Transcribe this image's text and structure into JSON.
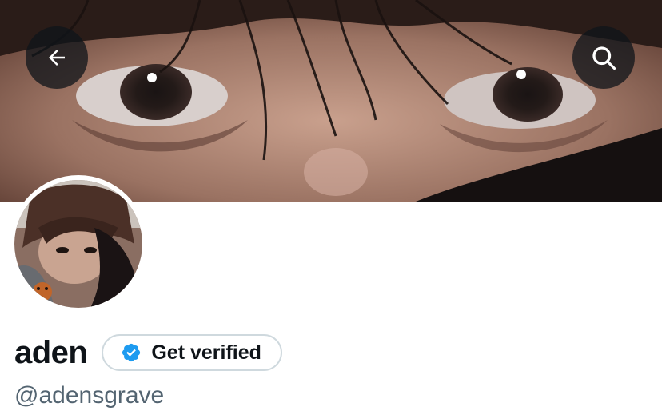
{
  "header": {
    "back_icon": "arrow-left-icon",
    "search_icon": "search-icon"
  },
  "profile": {
    "display_name": "aden",
    "handle": "@adensgrave",
    "verify_button": {
      "label": "Get verified",
      "icon": "verified-badge-icon",
      "badge_color": "#1d9bf0"
    }
  },
  "colors": {
    "text_primary": "#0f1419",
    "text_secondary": "#536471",
    "border": "#cfd9de",
    "accent": "#1d9bf0"
  }
}
